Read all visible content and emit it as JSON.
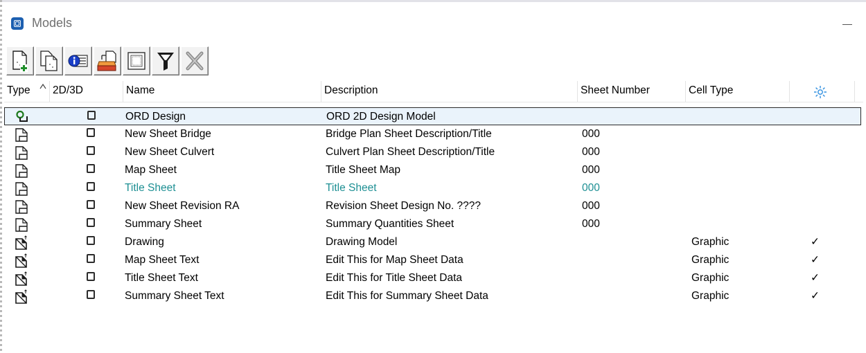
{
  "window": {
    "title": "Models"
  },
  "toolbar": {
    "buttons": [
      {
        "name": "create-model-button",
        "icon": "new-document-plus-icon"
      },
      {
        "name": "copy-model-button",
        "icon": "copy-document-icon"
      },
      {
        "name": "model-properties-button",
        "icon": "properties-info-icon"
      },
      {
        "name": "import-model-button",
        "icon": "import-tray-icon"
      },
      {
        "name": "attributes-button",
        "icon": "frame-icon"
      },
      {
        "name": "filter-button",
        "icon": "funnel-filter-icon"
      },
      {
        "name": "delete-button",
        "icon": "delete-x-icon"
      }
    ]
  },
  "columns": {
    "type": "Type",
    "dim": "2D/3D",
    "name": "Name",
    "description": "Description",
    "sheet_number": "Sheet Number",
    "cell_type": "Cell Type"
  },
  "rows": [
    {
      "type": "design",
      "name": "ORD Design",
      "description": "ORD 2D Design Model",
      "sheet_number": "",
      "cell_type": "",
      "check": "",
      "selected": true
    },
    {
      "type": "sheet",
      "name": "New Sheet Bridge",
      "description": "Bridge Plan Sheet Description/Title",
      "sheet_number": "000",
      "cell_type": "",
      "check": ""
    },
    {
      "type": "sheet",
      "name": "New Sheet Culvert",
      "description": "Culvert Plan Sheet Description/Title",
      "sheet_number": "000",
      "cell_type": "",
      "check": ""
    },
    {
      "type": "sheet",
      "name": "Map Sheet",
      "description": "Title Sheet Map",
      "sheet_number": "000",
      "cell_type": "",
      "check": ""
    },
    {
      "type": "sheet",
      "name": "Title Sheet",
      "description": "Title Sheet",
      "sheet_number": "000",
      "cell_type": "",
      "check": "",
      "active": true
    },
    {
      "type": "sheet",
      "name": "New Sheet Revision RA",
      "description": "Revision Sheet Design No. ????",
      "sheet_number": "000",
      "cell_type": "",
      "check": ""
    },
    {
      "type": "sheet",
      "name": "Summary Sheet",
      "description": "Summary Quantities Sheet",
      "sheet_number": "000",
      "cell_type": "",
      "check": ""
    },
    {
      "type": "drawing",
      "name": "Drawing",
      "description": "Drawing Model",
      "sheet_number": "",
      "cell_type": "Graphic",
      "check": "✓"
    },
    {
      "type": "drawing",
      "name": "Map Sheet Text",
      "description": "Edit This for Map Sheet Data",
      "sheet_number": "",
      "cell_type": "Graphic",
      "check": "✓"
    },
    {
      "type": "drawing",
      "name": "Title Sheet Text",
      "description": "Edit This for Title Sheet Data",
      "sheet_number": "",
      "cell_type": "Graphic",
      "check": "✓"
    },
    {
      "type": "drawing",
      "name": "Summary Sheet Text",
      "description": "Edit This for Summary Sheet Data",
      "sheet_number": "",
      "cell_type": "Graphic",
      "check": "✓"
    }
  ],
  "colors": {
    "active_text": "#1d8f93",
    "selection_bg": "#eaf3fb",
    "app_icon": "#1c5fb0",
    "sun_icon": "#2f8fe0"
  }
}
